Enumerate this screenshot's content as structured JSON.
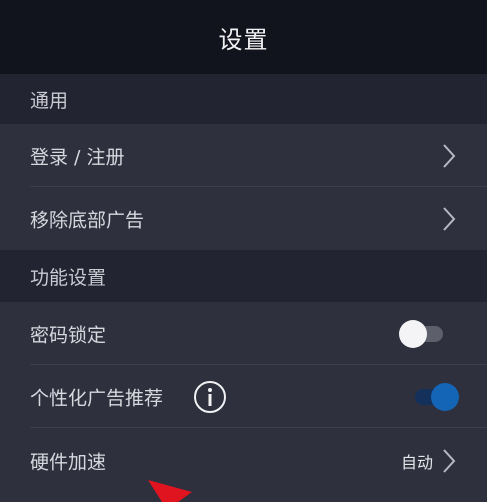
{
  "header": {
    "title": "设置"
  },
  "sections": {
    "general": "通用",
    "features": "功能设置"
  },
  "rows": {
    "login": {
      "label": "登录 / 注册",
      "icon": "chevron-right-icon"
    },
    "remove_ads": {
      "label": "移除底部广告",
      "icon": "chevron-right-icon"
    },
    "password_lock": {
      "label": "密码锁定",
      "toggle": "off"
    },
    "personalized_ads": {
      "label": "个性化广告推荐",
      "info_icon": "info-icon",
      "toggle": "on"
    },
    "hardware_accel": {
      "label": "硬件加速",
      "value": "自动",
      "icon": "chevron-right-icon"
    }
  },
  "colors": {
    "header_bg": "#12141d",
    "section_bg": "#222431",
    "row_bg": "#2e303e",
    "toggle_on": "#1565b6",
    "annotation_arrow": "#e0141e"
  },
  "annotation": {
    "icon": "red-arrow-icon"
  }
}
